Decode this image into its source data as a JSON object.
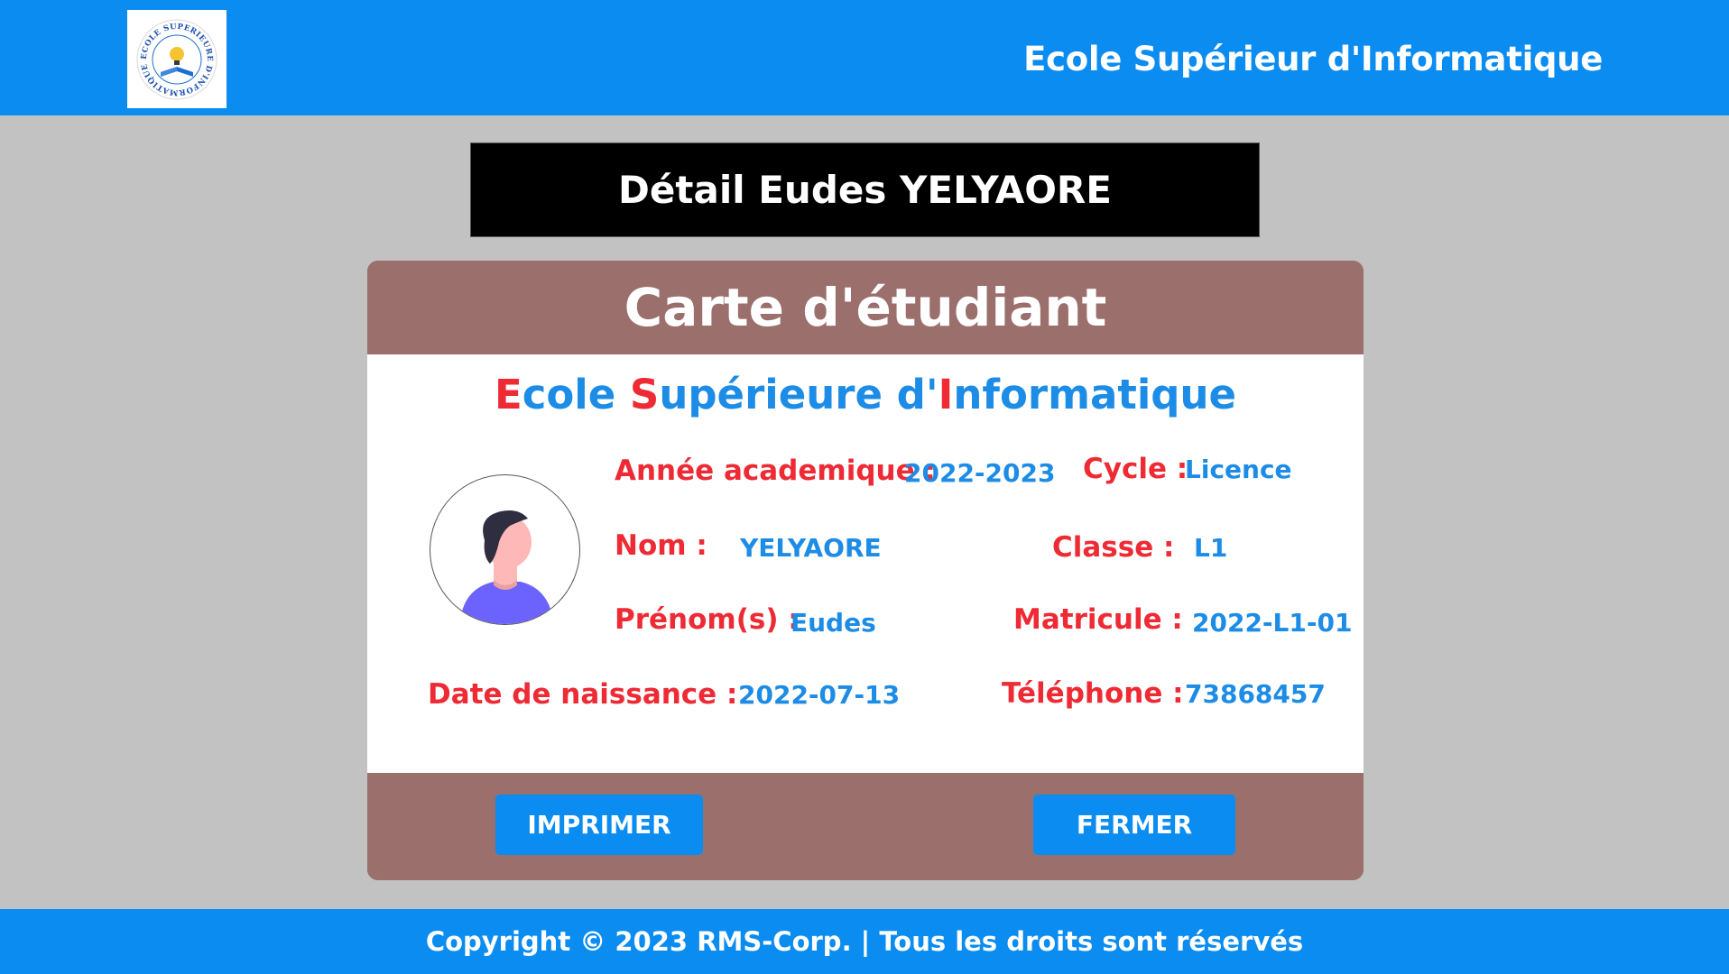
{
  "header": {
    "title": "Ecole Supérieur d'Informatique",
    "logo_text": "ECOLE SUPERIEURE D'INFORMATIQUE"
  },
  "banner": {
    "title": "Détail Eudes YELYAORE"
  },
  "card": {
    "title": "Carte d'étudiant",
    "school": {
      "p1": "E",
      "p2": "cole ",
      "p3": "S",
      "p4": "upérieure d'",
      "p5": "I",
      "p6": "nformatique"
    },
    "fields": {
      "annee_label": "Année academique :",
      "annee_value": "2022-2023",
      "cycle_label": "Cycle :",
      "cycle_value": "Licence",
      "nom_label": "Nom :",
      "nom_value": "YELYAORE",
      "classe_label": "Classe :",
      "classe_value": "L1",
      "prenom_label": "Prénom(s) :",
      "prenom_value": "Eudes",
      "matricule_label": "Matricule :",
      "matricule_value": "2022-L1-01",
      "naissance_label": "Date de naissance :",
      "naissance_value": "2022-07-13",
      "telephone_label": "Téléphone :",
      "telephone_value": "73868457"
    },
    "buttons": {
      "print": "IMPRIMER",
      "close": "FERMER"
    }
  },
  "footer": {
    "text": "Copyright © 2023 RMS-Corp. | Tous les droits sont réservés"
  },
  "colors": {
    "primary_blue": "#0a8cf0",
    "card_brown": "#9b6f6c",
    "label_red": "#ee2a34",
    "value_blue": "#1c8ce6",
    "background": "#c2c2c2"
  },
  "icons": {
    "avatar": "user-avatar-icon",
    "logo": "school-logo"
  }
}
